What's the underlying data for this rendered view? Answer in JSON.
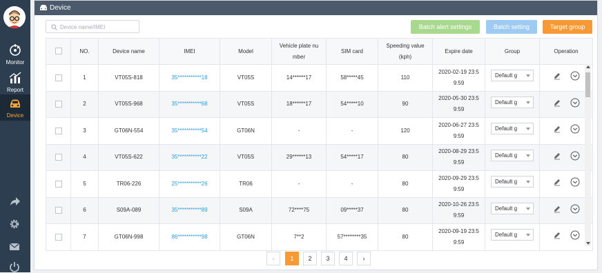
{
  "sidebar": {
    "items": [
      {
        "label": "Monitor",
        "icon": "monitor-icon"
      },
      {
        "label": "Report",
        "icon": "report-icon"
      },
      {
        "label": "Device",
        "icon": "car-icon",
        "active": true
      }
    ],
    "utility_icons": [
      "share-icon",
      "settings-icon",
      "mail-icon",
      "power-icon"
    ]
  },
  "header": {
    "title": "Device"
  },
  "toolbar": {
    "search_placeholder": "Device name/IMEI",
    "batch_alert_label": "Batch alert settings",
    "batch_setting_label": "Batch setting",
    "target_group_label": "Target group"
  },
  "table": {
    "columns": [
      "NO.",
      "Device name",
      "IMEI",
      "Model",
      "Vehicle plate nu\nmber",
      "SIM card",
      "Speeding value\n(kph)",
      "Expire date",
      "Group",
      "Operation"
    ],
    "rows": [
      {
        "no": "1",
        "name": "VT05S-818",
        "imei": "35***********18",
        "model": "VT05S",
        "plate": "14******17",
        "sim": "58*****45",
        "speed": "110",
        "expire": "2020-02-19 23:5\n9:59",
        "group": "Default g"
      },
      {
        "no": "2",
        "name": "VT05S-968",
        "imei": "35***********68",
        "model": "VT05S",
        "plate": "18******17",
        "sim": "54*****10",
        "speed": "90",
        "expire": "2020-05-30 23:5\n9:59",
        "group": "Default g"
      },
      {
        "no": "3",
        "name": "GT06N-554",
        "imei": "35***********54",
        "model": "GT06N",
        "plate": "-",
        "sim": "-",
        "speed": "120",
        "expire": "2020-06-27 23:5\n9:59",
        "group": "Default g"
      },
      {
        "no": "4",
        "name": "VT05S-622",
        "imei": "35***********22",
        "model": "VT05S",
        "plate": "29******13",
        "sim": "54*****17",
        "speed": "80",
        "expire": "2020-08-29 23:5\n9:59",
        "group": "Default g"
      },
      {
        "no": "5",
        "name": "TR06-226",
        "imei": "25***********26",
        "model": "TR06",
        "plate": "-",
        "sim": "-",
        "speed": "80",
        "expire": "2020-09-29 23:5\n9:59",
        "group": "Default g"
      },
      {
        "no": "6",
        "name": "S09A-089",
        "imei": "35***********89",
        "model": "S09A",
        "plate": "72****75",
        "sim": "09*****37",
        "speed": "80",
        "expire": "2020-10-26 23:5\n9:59",
        "group": "Default g"
      },
      {
        "no": "7",
        "name": "GT06N-998",
        "imei": "86***********98",
        "model": "GT06N",
        "plate": "7**2",
        "sim": "57********35",
        "speed": "80",
        "expire": "2020-09-19 23:5\n9:59",
        "group": "Default g"
      }
    ]
  },
  "pagination": {
    "prev": "‹",
    "pages": [
      "1",
      "2",
      "3",
      "4"
    ],
    "current": "1",
    "next": "›"
  },
  "colors": {
    "sidebar": "#2c3e50",
    "accent": "#f79a36",
    "link": "#2a9be0",
    "alert_button": "#a9d98e",
    "batch_button": "#9fcbf2"
  }
}
